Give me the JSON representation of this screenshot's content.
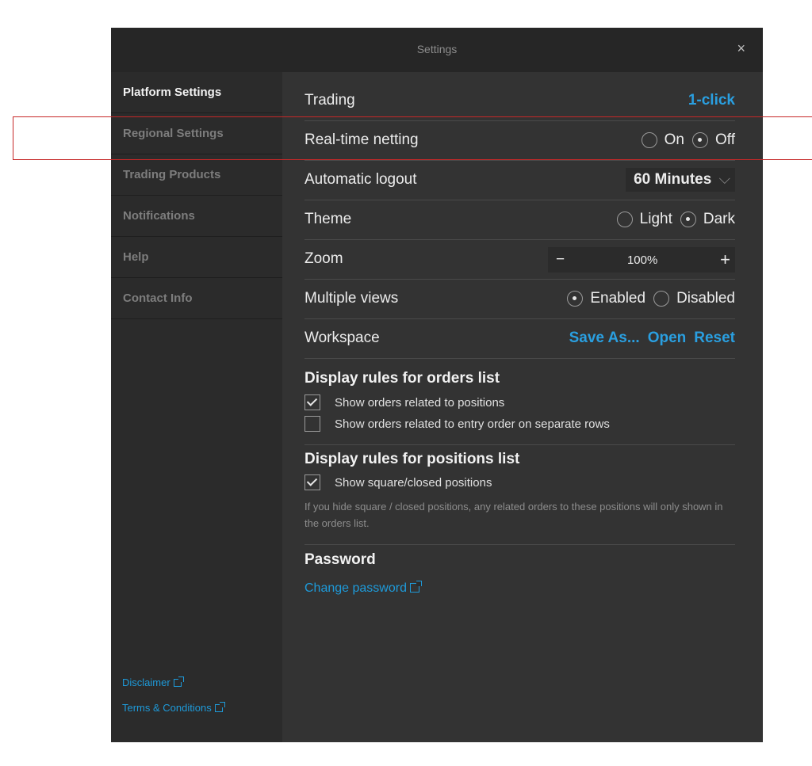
{
  "dialog": {
    "title": "Settings",
    "close_icon": "×"
  },
  "sidebar": {
    "items": [
      {
        "label": "Platform Settings",
        "active": true
      },
      {
        "label": "Regional Settings",
        "active": false
      },
      {
        "label": "Trading Products",
        "active": false
      },
      {
        "label": "Notifications",
        "active": false
      },
      {
        "label": "Help",
        "active": false
      },
      {
        "label": "Contact Info",
        "active": false
      }
    ],
    "footer_links": [
      "Disclaimer",
      "Terms & Conditions"
    ]
  },
  "settings": {
    "trading": {
      "label": "Trading",
      "value": "1-click"
    },
    "netting": {
      "label": "Real-time netting",
      "options": [
        "On",
        "Off"
      ],
      "selected": "Off"
    },
    "logout": {
      "label": "Automatic logout",
      "value": "60 Minutes"
    },
    "theme": {
      "label": "Theme",
      "options": [
        "Light",
        "Dark"
      ],
      "selected": "Dark"
    },
    "zoom": {
      "label": "Zoom",
      "minus": "−",
      "value": "100%",
      "plus": "+"
    },
    "views": {
      "label": "Multiple views",
      "options": [
        "Enabled",
        "Disabled"
      ],
      "selected": "Enabled"
    },
    "workspace": {
      "label": "Workspace",
      "actions": [
        "Save As...",
        "Open",
        "Reset"
      ]
    }
  },
  "orders_rules": {
    "title": "Display rules for orders list",
    "checks": [
      {
        "label": "Show orders related to positions",
        "checked": true
      },
      {
        "label": "Show orders related to entry order on separate rows",
        "checked": false
      }
    ]
  },
  "positions_rules": {
    "title": "Display rules for positions list",
    "check": {
      "label": "Show square/closed positions",
      "checked": true
    },
    "note": "If you hide square / closed positions, any related orders to these positions will only shown in the orders list."
  },
  "password": {
    "title": "Password",
    "link": "Change password"
  },
  "colors": {
    "accent": "#2a9fe0",
    "background": "#333333",
    "highlight": "#c62828"
  }
}
